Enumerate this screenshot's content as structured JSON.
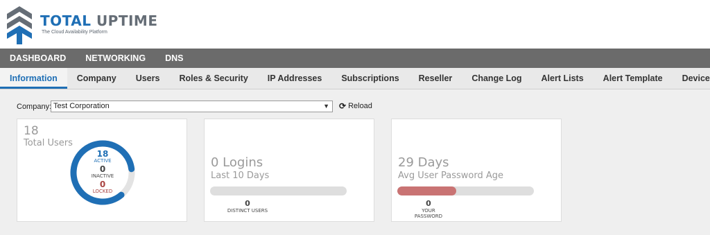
{
  "brand": {
    "name_part1": "TOTAL",
    "name_part2": "UPTIME",
    "tagline": "The Cloud Availability Platform"
  },
  "main_nav": [
    {
      "label": "DASHBOARD"
    },
    {
      "label": "NETWORKING"
    },
    {
      "label": "DNS"
    }
  ],
  "sub_nav": [
    {
      "label": "Information",
      "active": true
    },
    {
      "label": "Company"
    },
    {
      "label": "Users"
    },
    {
      "label": "Roles & Security"
    },
    {
      "label": "IP Addresses"
    },
    {
      "label": "Subscriptions"
    },
    {
      "label": "Reseller"
    },
    {
      "label": "Change Log"
    },
    {
      "label": "Alert Lists"
    },
    {
      "label": "Alert Template"
    },
    {
      "label": "Device Status"
    }
  ],
  "company_selector": {
    "label": "Company:",
    "value": "Test Corporation",
    "reload_label": "Reload"
  },
  "users_card": {
    "total": "18",
    "total_caption": "Total Users",
    "active": "18",
    "active_label": "ACTIVE",
    "inactive": "0",
    "inactive_label": "INACTIVE",
    "locked": "0",
    "locked_label": "LOCKED",
    "active_fraction": 1.0
  },
  "logins_card": {
    "title": "0 Logins",
    "subtitle": "Last 10 Days",
    "fill_fraction": 0,
    "count": "0",
    "count_label": "DISTINCT USERS"
  },
  "password_card": {
    "title": "29 Days",
    "subtitle": "Avg User Password Age",
    "fill_fraction": 0.43,
    "count": "0",
    "count_label_line1": "YOUR",
    "count_label_line2": "PASSWORD"
  },
  "colors": {
    "brand_blue": "#1f6fb5",
    "brand_gray": "#656d76",
    "nav_bg": "#6b6b6b",
    "inactive_gray": "#444444",
    "locked_red": "#a94442",
    "password_bar": "#c97373"
  },
  "icons": {
    "logo": "total-uptime-logo-icon",
    "reload": "refresh-icon",
    "select_arrow": "chevron-down-icon"
  }
}
